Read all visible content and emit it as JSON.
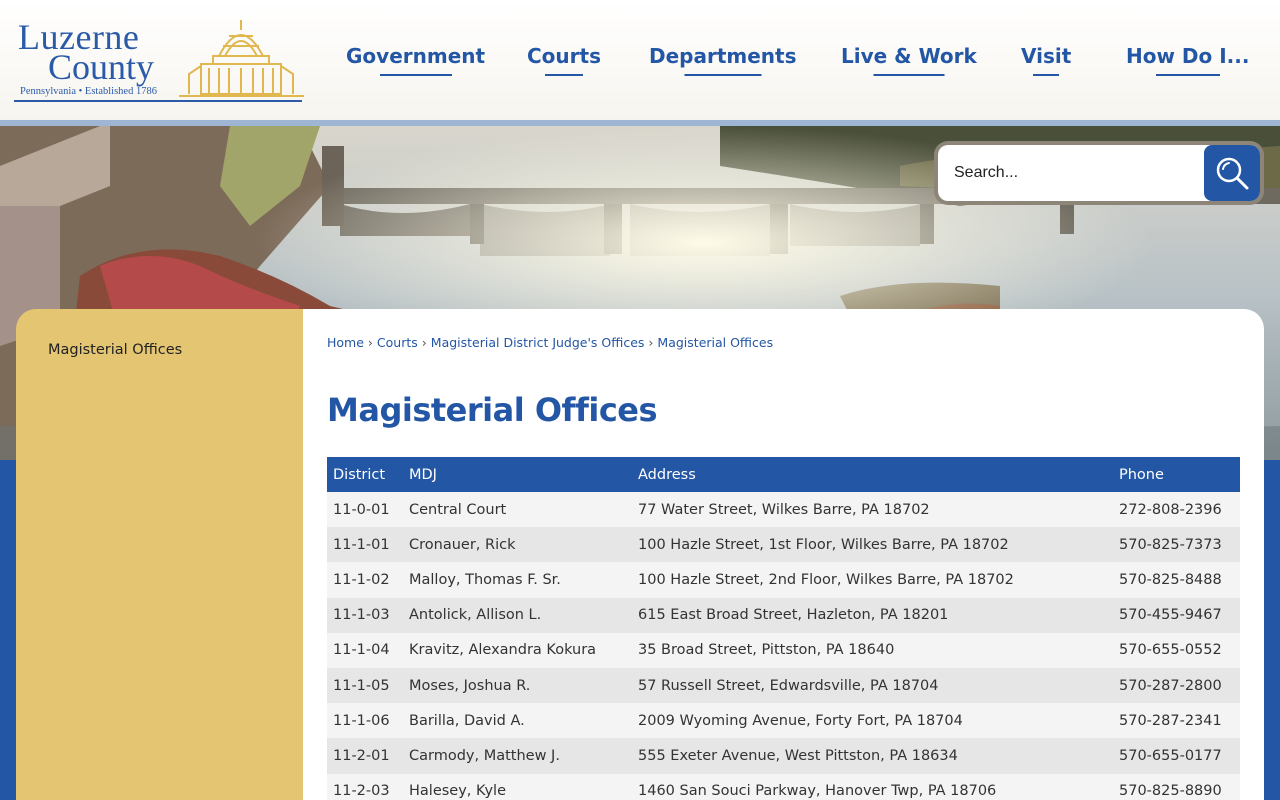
{
  "logo": {
    "line1": "Luzerne",
    "line2": "County",
    "subtitle": "Pennsylvania • Established 1786"
  },
  "nav": {
    "items": [
      {
        "label": "Government"
      },
      {
        "label": "Courts"
      },
      {
        "label": "Departments"
      },
      {
        "label": "Live & Work"
      },
      {
        "label": "Visit"
      },
      {
        "label": "How Do I..."
      }
    ]
  },
  "search": {
    "placeholder": "Search..."
  },
  "sidebar": {
    "items": [
      {
        "label": "Magisterial Offices"
      }
    ]
  },
  "breadcrumb": {
    "items": [
      "Home",
      "Courts",
      "Magisterial District Judge's Offices",
      "Magisterial Offices"
    ],
    "separator": "›"
  },
  "page_title": "Magisterial Offices",
  "table": {
    "headers": [
      "District",
      "MDJ",
      "Address",
      "Phone"
    ],
    "rows": [
      [
        "11-0-01",
        "Central Court",
        "77 Water Street, Wilkes Barre, PA 18702",
        "272-808-2396"
      ],
      [
        "11-1-01",
        "Cronauer, Rick",
        "100 Hazle Street, 1st Floor, Wilkes Barre, PA 18702",
        "570-825-7373"
      ],
      [
        "11-1-02",
        "Malloy, Thomas F. Sr.",
        "100 Hazle Street, 2nd Floor, Wilkes Barre, PA 18702",
        "570-825-8488"
      ],
      [
        "11-1-03",
        "Antolick, Allison L.",
        "615 East Broad Street, Hazleton, PA 18201",
        "570-455-9467"
      ],
      [
        "11-1-04",
        "Kravitz, Alexandra Kokura",
        "35 Broad Street, Pittston, PA 18640",
        "570-655-0552"
      ],
      [
        "11-1-05",
        "Moses, Joshua R.",
        "57 Russell Street, Edwardsville, PA 18704",
        "570-287-2800"
      ],
      [
        "11-1-06",
        "Barilla, David A.",
        "2009 Wyoming Avenue, Forty Fort, PA 18704",
        "570-287-2341"
      ],
      [
        "11-2-01",
        "Carmody, Matthew J.",
        "555 Exeter Avenue, West Pittston, PA 18634",
        "570-655-0177"
      ],
      [
        "11-2-03",
        "Halesey, Kyle",
        "1460 San Souci Parkway, Hanover Twp, PA 18706",
        "570-825-8890"
      ]
    ]
  },
  "colors": {
    "brand_blue": "#2356a4",
    "sidebar_gold": "#e3c572",
    "logo_gold": "#e0b84f"
  }
}
